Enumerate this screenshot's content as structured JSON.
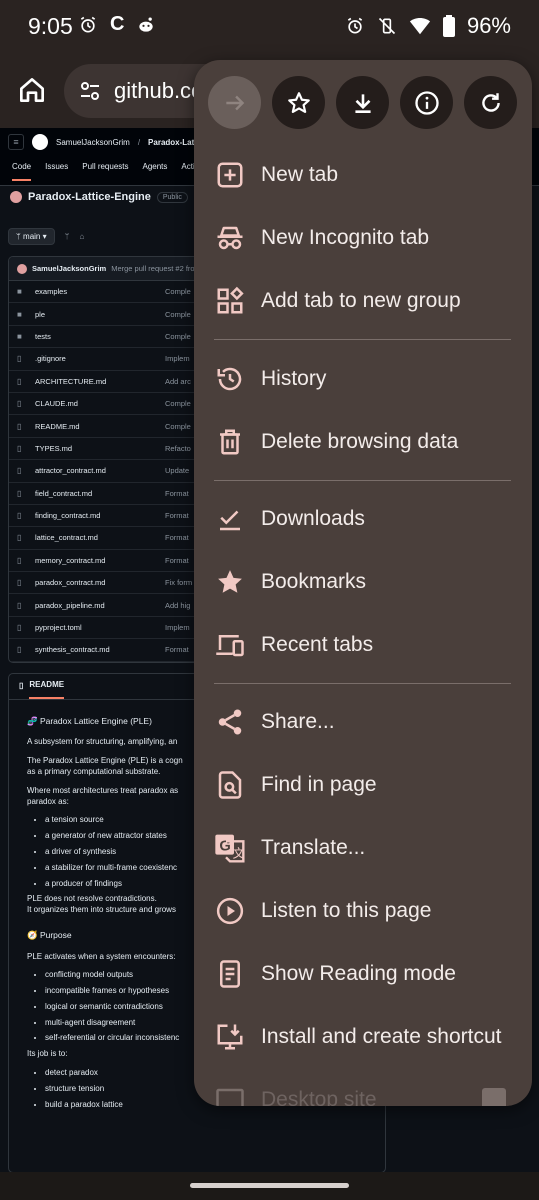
{
  "status_bar": {
    "time": "9:05",
    "battery": "96%",
    "left_icons": [
      "alarm-icon",
      "c-app-icon",
      "reddit-icon"
    ],
    "right_icons": [
      "alarm-icon",
      "mute-vibrate-icon",
      "wifi-icon",
      "battery-icon"
    ]
  },
  "omnibox": {
    "url_text": "github.co"
  },
  "github": {
    "owner": "SamuelJacksonGrim",
    "separator": "/",
    "repo_short": "Paradox-Lattice",
    "tabs": [
      "Code",
      "Issues",
      "Pull requests",
      "Agents",
      "Actio"
    ],
    "repo_name": "Paradox-Lattice-Engine",
    "visibility": "Public",
    "branch": "main",
    "commit_author": "SamuelJacksonGrim",
    "commit_message": "Merge pull request #2 fro",
    "files": [
      {
        "name": "examples",
        "type": "dir",
        "msg": "Comple"
      },
      {
        "name": "ple",
        "type": "dir",
        "msg": "Comple"
      },
      {
        "name": "tests",
        "type": "dir",
        "msg": "Comple"
      },
      {
        "name": ".gitignore",
        "type": "file",
        "msg": "Implem"
      },
      {
        "name": "ARCHITECTURE.md",
        "type": "file",
        "msg": "Add arc"
      },
      {
        "name": "CLAUDE.md",
        "type": "file",
        "msg": "Comple"
      },
      {
        "name": "README.md",
        "type": "file",
        "msg": "Comple"
      },
      {
        "name": "TYPES.md",
        "type": "file",
        "msg": "Refacto"
      },
      {
        "name": "attractor_contract.md",
        "type": "file",
        "msg": "Update"
      },
      {
        "name": "field_contract.md",
        "type": "file",
        "msg": "Format"
      },
      {
        "name": "finding_contract.md",
        "type": "file",
        "msg": "Format"
      },
      {
        "name": "lattice_contract.md",
        "type": "file",
        "msg": "Format"
      },
      {
        "name": "memory_contract.md",
        "type": "file",
        "msg": "Format"
      },
      {
        "name": "paradox_contract.md",
        "type": "file",
        "msg": "Fix form"
      },
      {
        "name": "paradox_pipeline.md",
        "type": "file",
        "msg": "Add hig"
      },
      {
        "name": "pyproject.toml",
        "type": "file",
        "msg": "Implem"
      },
      {
        "name": "synthesis_contract.md",
        "type": "file",
        "msg": "Format"
      }
    ],
    "readme": {
      "tab_label": "README",
      "title": "🧬 Paradox Lattice Engine (PLE)",
      "intro": "A subsystem for structuring, amplifying, an",
      "p1a": "The Paradox Lattice Engine (PLE) is a cogn",
      "p1b": "as a primary computational substrate.",
      "p2a": "Where most architectures treat paradox as",
      "p2b": "paradox as:",
      "list1": [
        "a tension source",
        "a generator of new attractor states",
        "a driver of synthesis",
        "a stabilizer for multi-frame coexistenc",
        "a producer of findings"
      ],
      "p3a": "PLE does not resolve contradictions.",
      "p3b": "It organizes them into structure and grows",
      "purpose_title": "🧭 Purpose",
      "purpose_intro": "PLE activates when a system encounters:",
      "list2": [
        "conflicting model outputs",
        "incompatible frames or hypotheses",
        "logical or semantic contradictions",
        "multi-agent disagreement",
        "self-referential or circular inconsistenc"
      ],
      "job_intro": "Its job is to:",
      "list3": [
        "detect paradox",
        "structure tension",
        "build a paradox lattice"
      ]
    }
  },
  "menu": {
    "top_icons": [
      "forward-icon",
      "bookmark-star-icon",
      "download-icon",
      "info-icon",
      "refresh-icon"
    ],
    "items": [
      {
        "label": "New tab",
        "icon": "new-tab-icon"
      },
      {
        "label": "New Incognito tab",
        "icon": "incognito-icon"
      },
      {
        "label": "Add tab to new group",
        "icon": "tab-group-icon"
      },
      {
        "label": "History",
        "icon": "history-icon"
      },
      {
        "label": "Delete browsing data",
        "icon": "trash-icon"
      },
      {
        "label": "Downloads",
        "icon": "downloads-icon"
      },
      {
        "label": "Bookmarks",
        "icon": "bookmarks-star-icon"
      },
      {
        "label": "Recent tabs",
        "icon": "recent-tabs-icon"
      },
      {
        "label": "Share...",
        "icon": "share-icon"
      },
      {
        "label": "Find in page",
        "icon": "find-in-page-icon"
      },
      {
        "label": "Translate...",
        "icon": "translate-icon"
      },
      {
        "label": "Listen to this page",
        "icon": "play-icon"
      },
      {
        "label": "Show Reading mode",
        "icon": "reading-mode-icon"
      },
      {
        "label": "Install and create shortcut",
        "icon": "install-icon"
      },
      {
        "label": "Desktop site",
        "icon": "desktop-icon"
      }
    ]
  },
  "colors": {
    "menu_bg": "#4a3f3b",
    "menu_text": "#f3ecea",
    "icon_accent": "#f1c9c4",
    "chrome_bar": "#2a2321"
  }
}
